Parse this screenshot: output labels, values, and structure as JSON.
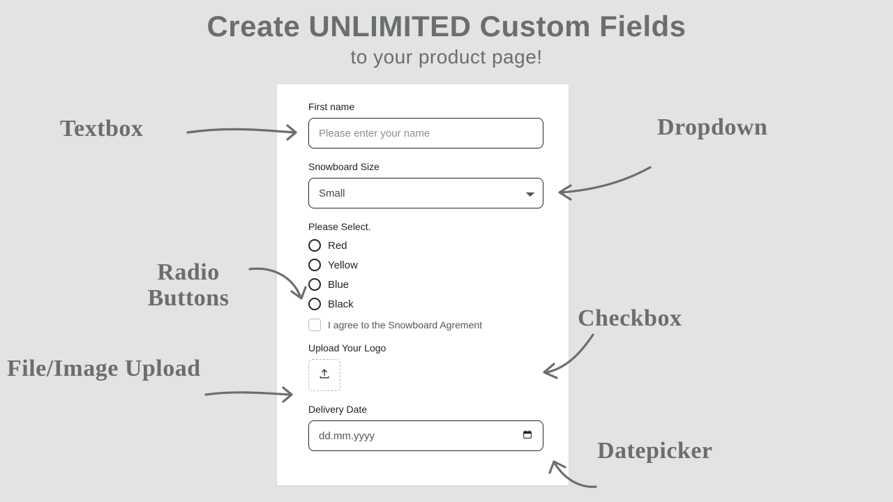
{
  "headline": {
    "title": "Create UNLIMITED Custom Fields",
    "subtitle": "to your product page!"
  },
  "form": {
    "first_name": {
      "label": "First name",
      "placeholder": "Please enter your name"
    },
    "size": {
      "label": "Snowboard Size",
      "selected": "Small"
    },
    "radio": {
      "label": "Please Select.",
      "options": [
        "Red",
        "Yellow",
        "Blue",
        "Black"
      ]
    },
    "agreement": {
      "label": "I agree to the Snowboard Agrement"
    },
    "upload": {
      "label": "Upload Your Logo"
    },
    "date": {
      "label": "Delivery Date",
      "placeholder": "dd.mm.yyyy"
    }
  },
  "callouts": {
    "textbox": "Textbox",
    "dropdown": "Dropdown",
    "radio": "Radio Buttons",
    "checkbox": "Checkbox",
    "upload": "File/Image Upload",
    "date": "Datepicker"
  }
}
